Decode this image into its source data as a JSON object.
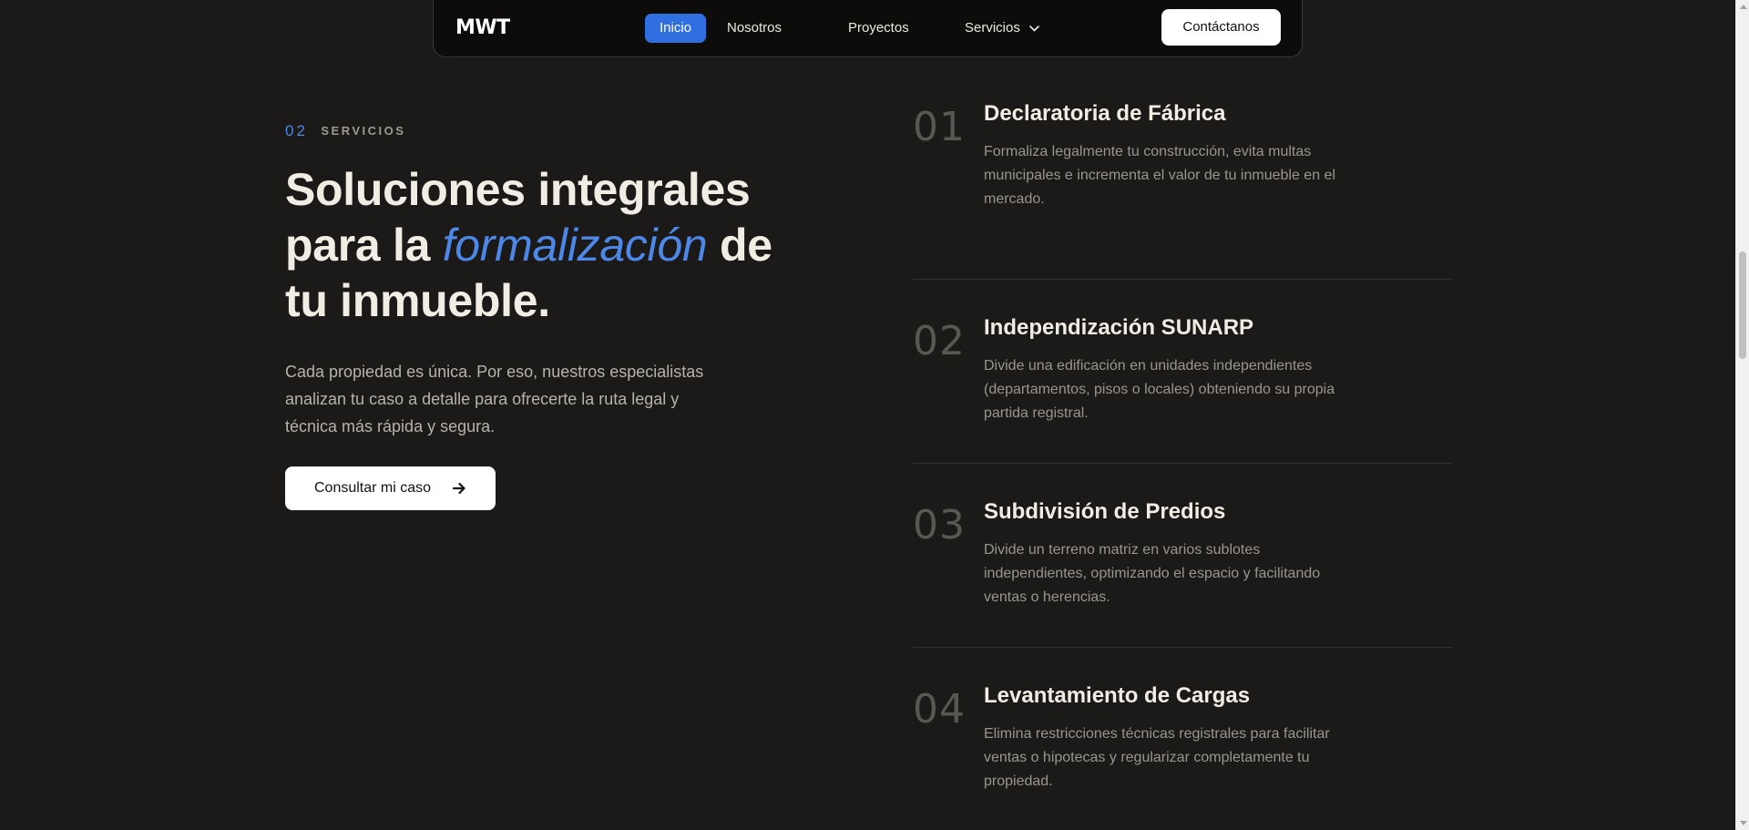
{
  "nav": {
    "logo": "MWT",
    "items": [
      {
        "label": "Inicio",
        "active": true
      },
      {
        "label": "Nosotros"
      },
      {
        "label": "Proyectos"
      },
      {
        "label": "Servicios",
        "has_dropdown": true
      }
    ],
    "contact_label": "Contáctanos"
  },
  "hero": {
    "eyebrow_number": "02",
    "eyebrow_label": "SERVICIOS",
    "headline_part1": "Soluciones integrales para la ",
    "headline_accent": "formalización",
    "headline_part2": " de tu inmueble.",
    "lead": "Cada propiedad es única. Por eso, nuestros especialistas analizan tu caso a detalle para ofrecerte la ruta legal y técnica más rápida y segura.",
    "cta_label": "Consultar mi caso"
  },
  "services": [
    {
      "number": "01",
      "title": "Declaratoria de Fábrica",
      "description": "Formaliza legalmente tu construcción, evita multas municipales e incrementa el valor de tu inmueble en el mercado."
    },
    {
      "number": "02",
      "title": "Independización SUNARP",
      "description": "Divide una edificación en unidades independientes (departamentos, pisos o locales) obteniendo su propia partida registral."
    },
    {
      "number": "03",
      "title": "Subdivisión de Predios",
      "description": "Divide un terreno matriz en varios sublotes independientes, optimizando el espacio y facilitando ventas o herencias."
    },
    {
      "number": "04",
      "title": "Levantamiento de Cargas",
      "description": "Elimina restricciones técnicas registrales para facilitar ventas o hipotecas y regularizar completamente tu propiedad."
    }
  ],
  "colors": {
    "background": "#1c1a18",
    "accent": "#4d87e8",
    "nav_active": "#2f6fe0"
  },
  "icons": {
    "cta": "arrow-right-icon",
    "dropdown": "chevron-down-icon"
  }
}
